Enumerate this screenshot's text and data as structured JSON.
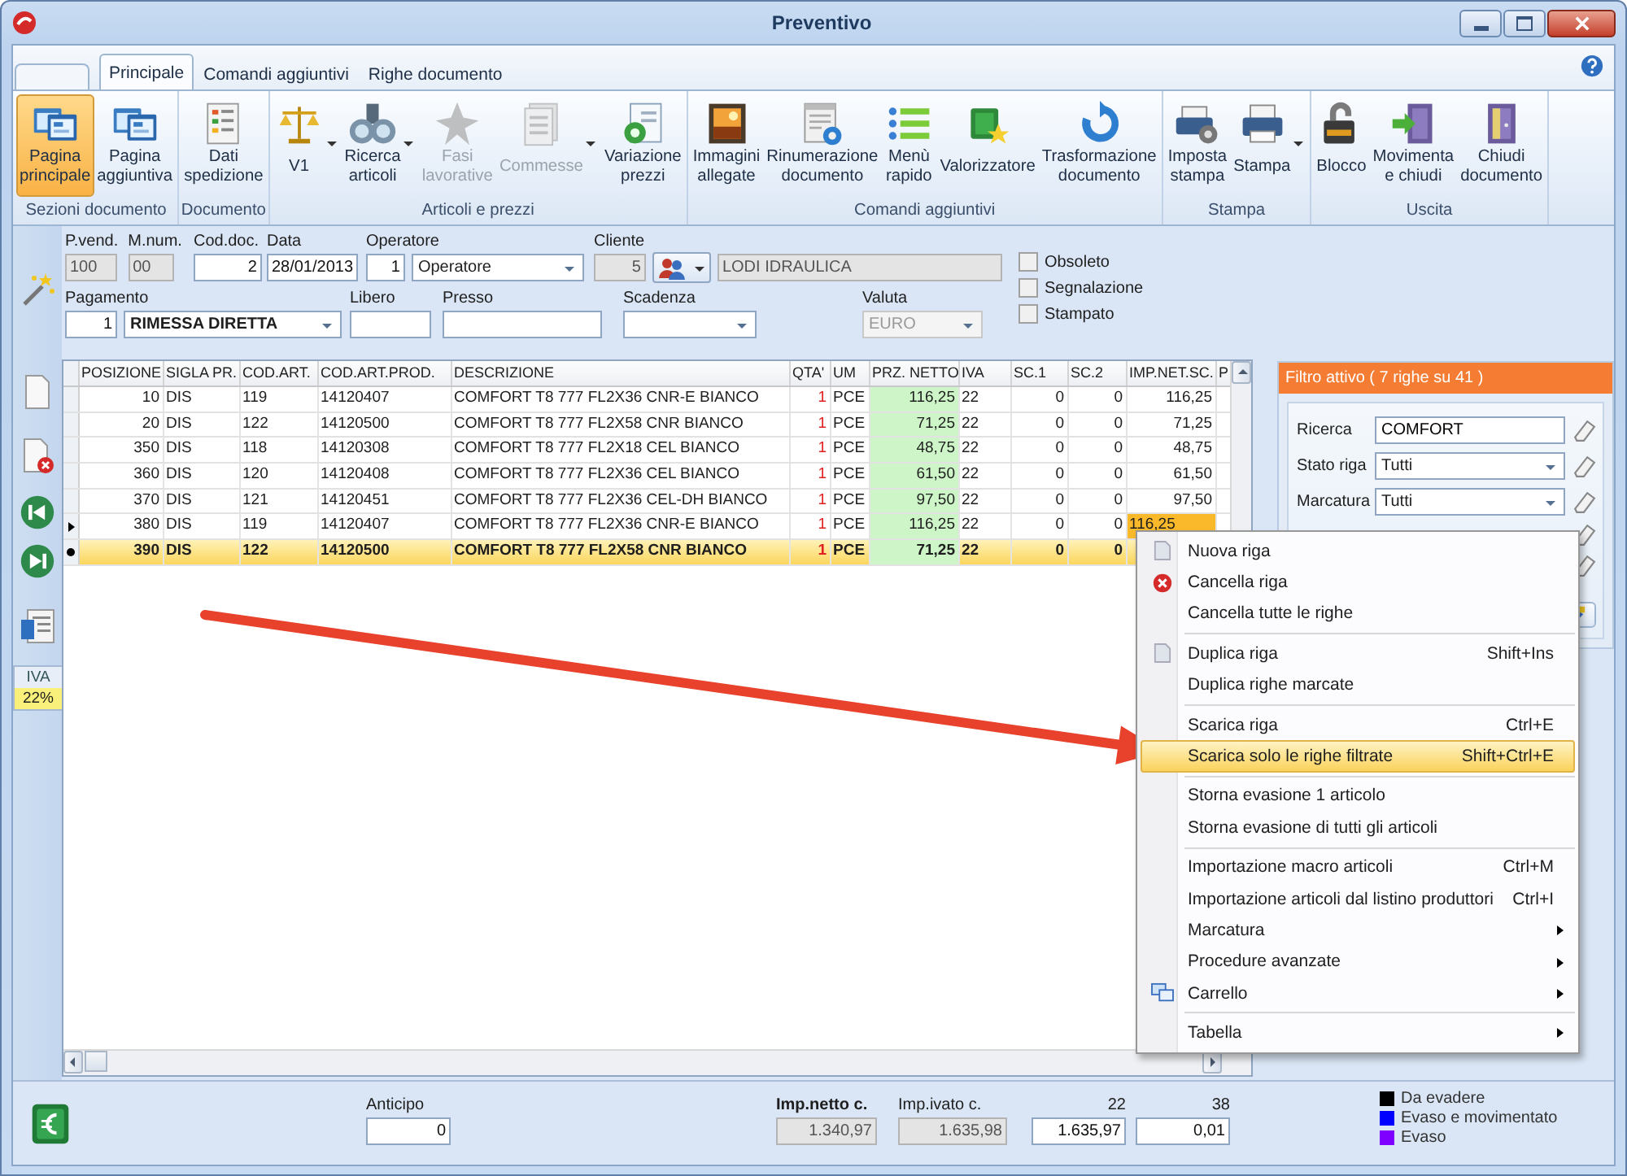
{
  "window": {
    "title": "Preventivo"
  },
  "tabs": [
    {
      "label": "Principale",
      "selected": true
    },
    {
      "label": "Comandi aggiuntivi",
      "selected": false
    },
    {
      "label": "Righe documento",
      "selected": false
    }
  ],
  "ribbon": {
    "groups": [
      {
        "label": "Sezioni documento",
        "buttons": [
          {
            "label": "Pagina\nprincipale",
            "selected": true,
            "disabled": false,
            "dropdown": false
          },
          {
            "label": "Pagina\naggiuntiva",
            "selected": false,
            "disabled": false,
            "dropdown": false
          }
        ]
      },
      {
        "label": "Documento",
        "buttons": [
          {
            "label": "Dati\nspedizione",
            "selected": false,
            "disabled": false,
            "dropdown": false
          }
        ]
      },
      {
        "label": "Articoli e prezzi",
        "buttons": [
          {
            "label": "V1",
            "selected": false,
            "disabled": false,
            "dropdown": true
          },
          {
            "label": "Ricerca\narticoli",
            "selected": false,
            "disabled": false,
            "dropdown": true
          },
          {
            "label": "Fasi\nlavorative",
            "selected": false,
            "disabled": true,
            "dropdown": false
          },
          {
            "label": "Commesse",
            "selected": false,
            "disabled": true,
            "dropdown": true
          },
          {
            "label": "Variazione\nprezzi",
            "selected": false,
            "disabled": false,
            "dropdown": false
          }
        ]
      },
      {
        "label": "Comandi aggiuntivi",
        "buttons": [
          {
            "label": "Immagini\nallegate",
            "selected": false,
            "disabled": false,
            "dropdown": false
          },
          {
            "label": "Rinumerazione\ndocumento",
            "selected": false,
            "disabled": false,
            "dropdown": false
          },
          {
            "label": "Menù\nrapido",
            "selected": false,
            "disabled": false,
            "dropdown": false
          },
          {
            "label": "Valorizzatore",
            "selected": false,
            "disabled": false,
            "dropdown": false
          },
          {
            "label": "Trasformazione\ndocumento",
            "selected": false,
            "disabled": false,
            "dropdown": false
          }
        ]
      },
      {
        "label": "Stampa",
        "buttons": [
          {
            "label": "Imposta\nstampa",
            "selected": false,
            "disabled": false,
            "dropdown": false
          },
          {
            "label": "Stampa",
            "selected": false,
            "disabled": false,
            "dropdown": true
          }
        ]
      },
      {
        "label": "Uscita",
        "buttons": [
          {
            "label": "Blocco",
            "selected": false,
            "disabled": false,
            "dropdown": false
          },
          {
            "label": "Movimenta\ne chiudi",
            "selected": false,
            "disabled": false,
            "dropdown": false
          },
          {
            "label": "Chiudi\ndocumento",
            "selected": false,
            "disabled": false,
            "dropdown": false
          }
        ]
      }
    ]
  },
  "form": {
    "top": [
      {
        "label": "P.vend.",
        "kind": "text",
        "value": "100",
        "disabled": true
      },
      {
        "label": "M.num.",
        "kind": "text",
        "value": "00",
        "disabled": true
      },
      {
        "label": "Cod.doc.",
        "kind": "text",
        "value": "2",
        "disabled": false
      },
      {
        "label": "Data",
        "kind": "text",
        "value": "28/01/2013",
        "disabled": false
      },
      {
        "label": "Operatore",
        "kind": "code-combo",
        "code": "1",
        "value": "Operatore",
        "disabled": false
      },
      {
        "label": "Cliente",
        "kind": "code-lookup",
        "code": "5",
        "value": "LODI IDRAULICA",
        "disabled": true
      }
    ],
    "bottom": [
      {
        "label": "Pagamento",
        "kind": "code-combo",
        "code": "1",
        "value": "RIMESSA DIRETTA",
        "disabled": false
      },
      {
        "label": "Libero",
        "kind": "text",
        "disabled": false
      },
      {
        "label": "Presso",
        "kind": "text",
        "disabled": false
      },
      {
        "label": "Scadenza",
        "kind": "combo",
        "disabled": false
      },
      {
        "label": "Valuta",
        "kind": "combo",
        "value": "EURO",
        "disabled": true
      }
    ],
    "flags": [
      {
        "label": "Obsoleto",
        "checked": false
      },
      {
        "label": "Segnalazione",
        "checked": false
      },
      {
        "label": "Stampato",
        "checked": false
      }
    ]
  },
  "side": {
    "iva": {
      "label": "IVA",
      "value": "22%"
    }
  },
  "table": {
    "columns": [
      "POSIZIONE",
      "SIGLA PR.",
      "COD.ART.",
      "COD.ART.PROD.",
      "DESCRIZIONE",
      "QTA'",
      "UM",
      "PRZ. NETTO",
      "IVA",
      "SC.1",
      "SC.2",
      "IMP.NET.SC.",
      "P"
    ],
    "rows": [
      {
        "selected": false,
        "current": false,
        "flagged": false,
        "cells": [
          "10",
          "DIS",
          "119",
          "14120407",
          "COMFORT T8 777 FL2X36 CNR-E BIANCO",
          "1",
          "PCE",
          "116,25",
          "22",
          "0",
          "0",
          "116,25"
        ]
      },
      {
        "selected": false,
        "current": false,
        "flagged": false,
        "cells": [
          "20",
          "DIS",
          "122",
          "14120500",
          "COMFORT T8 777 FL2X58 CNR BIANCO",
          "1",
          "PCE",
          "71,25",
          "22",
          "0",
          "0",
          "71,25"
        ]
      },
      {
        "selected": false,
        "current": false,
        "flagged": false,
        "cells": [
          "350",
          "DIS",
          "118",
          "14120308",
          "COMFORT T8 777 FL2X18 CEL BIANCO",
          "1",
          "PCE",
          "48,75",
          "22",
          "0",
          "0",
          "48,75"
        ]
      },
      {
        "selected": false,
        "current": false,
        "flagged": false,
        "cells": [
          "360",
          "DIS",
          "120",
          "14120408",
          "COMFORT T8 777 FL2X36 CEL BIANCO",
          "1",
          "PCE",
          "61,50",
          "22",
          "0",
          "0",
          "61,50"
        ]
      },
      {
        "selected": false,
        "current": false,
        "flagged": false,
        "cells": [
          "370",
          "DIS",
          "121",
          "14120451",
          "COMFORT T8 777 FL2X36 CEL-DH BIANCO",
          "1",
          "PCE",
          "97,50",
          "22",
          "0",
          "0",
          "97,50"
        ]
      },
      {
        "selected": false,
        "current": true,
        "flagged": true,
        "cells": [
          "380",
          "DIS",
          "119",
          "14120407",
          "COMFORT T8 777 FL2X36 CNR-E BIANCO",
          "1",
          "PCE",
          "116,25",
          "22",
          "0",
          "0",
          "116,25"
        ]
      },
      {
        "selected": true,
        "current": false,
        "flagged": false,
        "cells": [
          "390",
          "DIS",
          "122",
          "14120500",
          "COMFORT T8 777 FL2X58 CNR BIANCO",
          "1",
          "PCE",
          "71,25",
          "22",
          "0",
          "0"
        ]
      }
    ]
  },
  "filter": {
    "title": "Filtro attivo ( 7 righe su 41 )",
    "rows": [
      {
        "label": "Ricerca",
        "kind": "text",
        "value": "COMFORT"
      },
      {
        "label": "Stato riga",
        "kind": "combo",
        "value": "Tutti"
      },
      {
        "label": "Marcatura",
        "kind": "combo",
        "value": "Tutti"
      }
    ]
  },
  "context_menu": {
    "groups": [
      {
        "items": [
          {
            "label": "Nuova riga",
            "submenu": false,
            "selected": false
          },
          {
            "label": "Cancella riga",
            "submenu": false,
            "selected": false
          },
          {
            "label": "Cancella tutte le righe",
            "submenu": false,
            "selected": false
          }
        ]
      },
      {
        "items": [
          {
            "label": "Duplica riga",
            "shortcut": "Shift+Ins",
            "submenu": false,
            "selected": false
          },
          {
            "label": "Duplica righe marcate",
            "submenu": false,
            "selected": false
          }
        ]
      },
      {
        "items": [
          {
            "label": "Scarica riga",
            "shortcut": "Ctrl+E",
            "submenu": false,
            "selected": false
          },
          {
            "label": "Scarica solo le righe filtrate",
            "shortcut": "Shift+Ctrl+E",
            "submenu": false,
            "selected": true
          }
        ]
      },
      {
        "items": [
          {
            "label": "Storna evasione 1 articolo",
            "submenu": false,
            "selected": false
          },
          {
            "label": "Storna evasione di tutti gli articoli",
            "submenu": false,
            "selected": false
          }
        ]
      },
      {
        "items": [
          {
            "label": "Importazione macro articoli",
            "shortcut": "Ctrl+M",
            "submenu": false,
            "selected": false
          },
          {
            "label": "Importazione articoli dal listino produttori",
            "shortcut": "Ctrl+I",
            "submenu": false,
            "selected": false
          },
          {
            "label": "Marcatura",
            "submenu": true,
            "selected": false
          },
          {
            "label": "Procedure avanzate",
            "submenu": true,
            "selected": false
          },
          {
            "label": "Carrello",
            "submenu": true,
            "selected": false
          }
        ]
      },
      {
        "items": [
          {
            "label": "Tabella",
            "submenu": true,
            "selected": false
          }
        ]
      }
    ]
  },
  "footer": {
    "anticipo": {
      "label": "Anticipo",
      "value": "0"
    },
    "totals": [
      {
        "label": "Imp.netto c.",
        "value": "1.340,97",
        "bold": true,
        "disabled": true
      },
      {
        "label": "Imp.ivato c.",
        "value": "1.635,98",
        "bold": false,
        "disabled": true
      },
      {
        "label": "22",
        "value": "1.635,97",
        "bold": false,
        "disabled": false
      },
      {
        "label": "38",
        "value": "0,01",
        "bold": false,
        "disabled": false
      }
    ],
    "legend": [
      {
        "label": "Da evadere",
        "color": "#000000"
      },
      {
        "label": "Evaso e movimentato",
        "color": "#0000ff"
      },
      {
        "label": "Evaso",
        "color": "#8000ff"
      }
    ]
  }
}
